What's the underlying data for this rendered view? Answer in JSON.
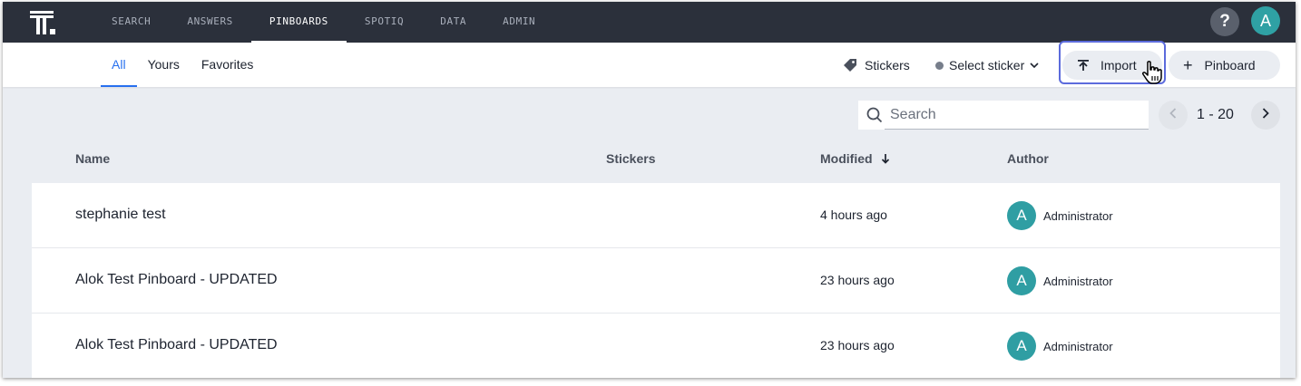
{
  "nav": {
    "items": [
      {
        "label": "SEARCH",
        "active": false
      },
      {
        "label": "ANSWERS",
        "active": false
      },
      {
        "label": "PINBOARDS",
        "active": true
      },
      {
        "label": "SPOTIQ",
        "active": false
      },
      {
        "label": "DATA",
        "active": false
      },
      {
        "label": "ADMIN",
        "active": false
      }
    ],
    "help_label": "?",
    "user_initial": "A"
  },
  "subnav": {
    "tabs": [
      {
        "label": "All",
        "active": true
      },
      {
        "label": "Yours",
        "active": false
      },
      {
        "label": "Favorites",
        "active": false
      }
    ],
    "stickers_label": "Stickers",
    "select_sticker_label": "Select sticker",
    "import_label": "Import",
    "pinboard_label": "Pinboard"
  },
  "search": {
    "placeholder": "Search"
  },
  "pagination": {
    "range": "1 - 20"
  },
  "table": {
    "columns": {
      "name": "Name",
      "stickers": "Stickers",
      "modified": "Modified",
      "author": "Author"
    },
    "rows": [
      {
        "name": "stephanie test",
        "modified": "4 hours ago",
        "author_initial": "A",
        "author": "Administrator"
      },
      {
        "name": "Alok Test Pinboard - UPDATED",
        "modified": "23 hours ago",
        "author_initial": "A",
        "author": "Administrator"
      },
      {
        "name": "Alok Test Pinboard - UPDATED",
        "modified": "23 hours ago",
        "author_initial": "A",
        "author": "Administrator"
      }
    ]
  },
  "colors": {
    "topbar": "#2b303b",
    "accent": "#2770ef",
    "avatar": "#2fa1a4",
    "highlight": "#5c6bdc"
  },
  "icons": {
    "logo": "thoughtspot-logo-icon",
    "sticker": "tag-icon",
    "import": "upload-icon",
    "search": "search-icon",
    "sort": "arrow-down-icon"
  }
}
